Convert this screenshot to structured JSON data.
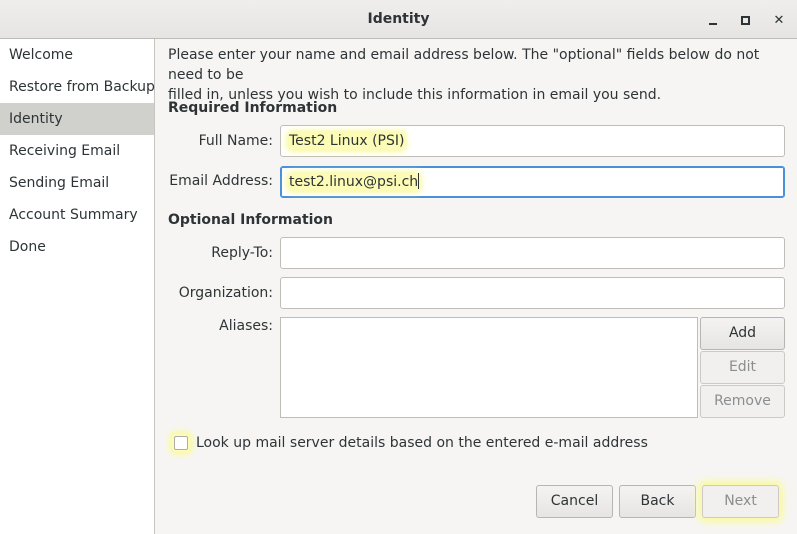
{
  "window": {
    "title": "Identity",
    "controls": [
      "minimize-icon",
      "maximize-icon",
      "close-icon"
    ],
    "close_glyph": "✕"
  },
  "sidebar": {
    "items": [
      {
        "label": "Welcome"
      },
      {
        "label": "Restore from Backup"
      },
      {
        "label": "Identity",
        "active": true
      },
      {
        "label": "Receiving Email"
      },
      {
        "label": "Sending Email"
      },
      {
        "label": "Account Summary"
      },
      {
        "label": "Done"
      }
    ]
  },
  "main": {
    "intro_line1": "Please enter your name and email address below. The \"optional\" fields below do not need to be",
    "intro_line2": "filled in, unless you wish to include this information in email you send.",
    "required_title": "Required Information",
    "full_name_label": "Full Name:",
    "full_name_value": "Test2 Linux (PSI)",
    "email_label": "Email Address:",
    "email_value": "test2.linux@psi.ch",
    "optional_title": "Optional Information",
    "reply_to_label": "Reply-To:",
    "reply_to_value": "",
    "organization_label": "Organization:",
    "organization_value": "",
    "aliases_label": "Aliases:",
    "add_label": "Add",
    "edit_label": "Edit",
    "remove_label": "Remove",
    "lookup_label": "Look up mail server details based on the entered e-mail address",
    "lookup_checked": false
  },
  "buttons": {
    "cancel": "Cancel",
    "back": "Back",
    "next": "Next"
  },
  "colors": {
    "highlight": "#fcfcb6",
    "focus": "#4a90d9",
    "sidebar_active": "#d0d0cd"
  }
}
